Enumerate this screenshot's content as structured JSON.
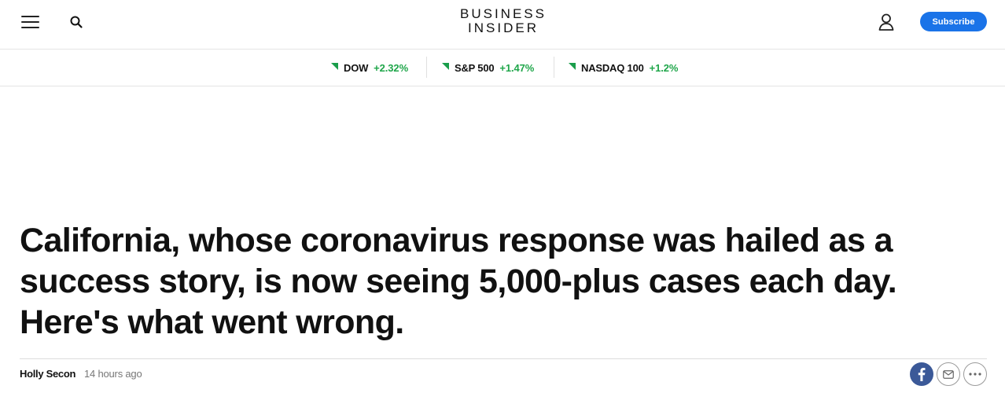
{
  "header": {
    "logo_line1": "BUSINESS",
    "logo_line2": "INSIDER",
    "subscribe_label": "Subscribe",
    "icons": [
      "menu-icon",
      "search-icon",
      "account-icon"
    ]
  },
  "tickers": [
    {
      "name": "DOW",
      "change": "+2.32%",
      "direction": "up"
    },
    {
      "name": "S&P 500",
      "change": "+1.47%",
      "direction": "up"
    },
    {
      "name": "NASDAQ 100",
      "change": "+1.2%",
      "direction": "up"
    }
  ],
  "article": {
    "headline": "California, whose coronavirus response was hailed as a success story, is now seeing 5,000-plus cases each day. Here's what went wrong.",
    "author": "Holly Secon",
    "timestamp": "14 hours ago"
  },
  "share": {
    "icons": [
      "facebook-icon",
      "mail-icon",
      "more-icon"
    ]
  },
  "colors": {
    "accent": "#1a73e8",
    "positive": "#1fa64a",
    "facebook": "#3b5998"
  }
}
